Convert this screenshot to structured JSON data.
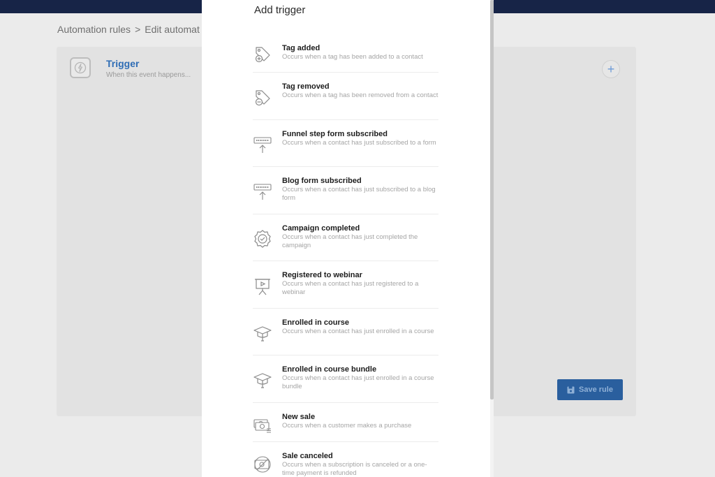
{
  "breadcrumb": {
    "root": "Automation rules",
    "separator": ">",
    "current": "Edit automat"
  },
  "trigger_card": {
    "title": "Trigger",
    "subtitle": "When this event happens..."
  },
  "save_button": {
    "label": "Save rule"
  },
  "modal": {
    "title": "Add trigger",
    "items": [
      {
        "title": "Tag added",
        "description": "Occurs when a tag has been added to a contact",
        "icon": "tag-add-icon"
      },
      {
        "title": "Tag removed",
        "description": "Occurs when a tag has been removed from a contact",
        "icon": "tag-remove-icon"
      },
      {
        "title": "Funnel step form subscribed",
        "description": "Occurs when a contact has just subscribed to a form",
        "icon": "subscribe-icon"
      },
      {
        "title": "Blog form subscribed",
        "description": "Occurs when a contact has just subscribed to a blog form",
        "icon": "subscribe-icon"
      },
      {
        "title": "Campaign completed",
        "description": "Occurs when a contact has just completed the campaign",
        "icon": "badge-check-icon"
      },
      {
        "title": "Registered to webinar",
        "description": "Occurs when a contact has just registered to a webinar",
        "icon": "presentation-icon"
      },
      {
        "title": "Enrolled in course",
        "description": "Occurs when a contact has just enrolled in a course",
        "icon": "graduation-cap-icon"
      },
      {
        "title": "Enrolled in course bundle",
        "description": "Occurs when a contact has just enrolled in a course bundle",
        "icon": "graduation-cap-icon"
      },
      {
        "title": "New sale",
        "description": "Occurs when a customer makes a purchase",
        "icon": "money-icon"
      },
      {
        "title": "Sale canceled",
        "description": "Occurs when a subscription is canceled or a one-time payment is refunded",
        "icon": "money-cancel-icon"
      }
    ]
  },
  "colors": {
    "topbar": "#172447",
    "accent": "#2f6db5",
    "save_button": "#2a5f9e"
  }
}
